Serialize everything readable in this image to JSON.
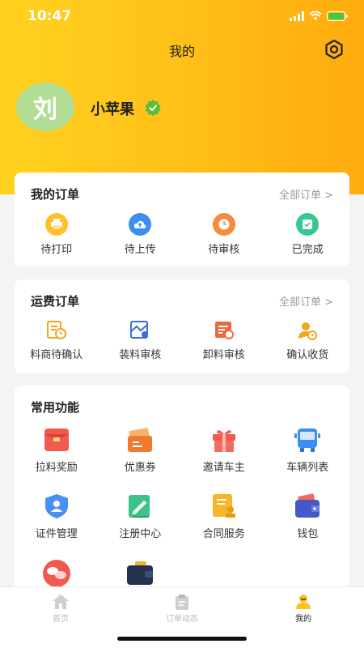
{
  "status": {
    "time": "10:47"
  },
  "header": {
    "title": "我的"
  },
  "profile": {
    "avatar_char": "刘",
    "name": "小苹果"
  },
  "orders": {
    "title": "我的订单",
    "more": "全部订单 >",
    "items": [
      {
        "label": "待打印"
      },
      {
        "label": "待上传"
      },
      {
        "label": "待审核"
      },
      {
        "label": "已完成"
      }
    ]
  },
  "freight": {
    "title": "运费订单",
    "more": "全部订单 >",
    "items": [
      {
        "label": "料商待确认"
      },
      {
        "label": "装料审核"
      },
      {
        "label": "卸料审核"
      },
      {
        "label": "确认收货"
      }
    ]
  },
  "functions": {
    "title": "常用功能",
    "items": [
      {
        "label": "拉料奖励"
      },
      {
        "label": "优惠券"
      },
      {
        "label": "邀请车主"
      },
      {
        "label": "车辆列表"
      },
      {
        "label": "证件管理"
      },
      {
        "label": "注册中心"
      },
      {
        "label": "合同服务"
      },
      {
        "label": "钱包"
      }
    ]
  },
  "tabbar": {
    "items": [
      {
        "label": "首页"
      },
      {
        "label": "订单动态"
      },
      {
        "label": "我的"
      }
    ]
  },
  "colors": {
    "accent": "#ffb20f",
    "avatar_bg": "#b2dd97"
  }
}
